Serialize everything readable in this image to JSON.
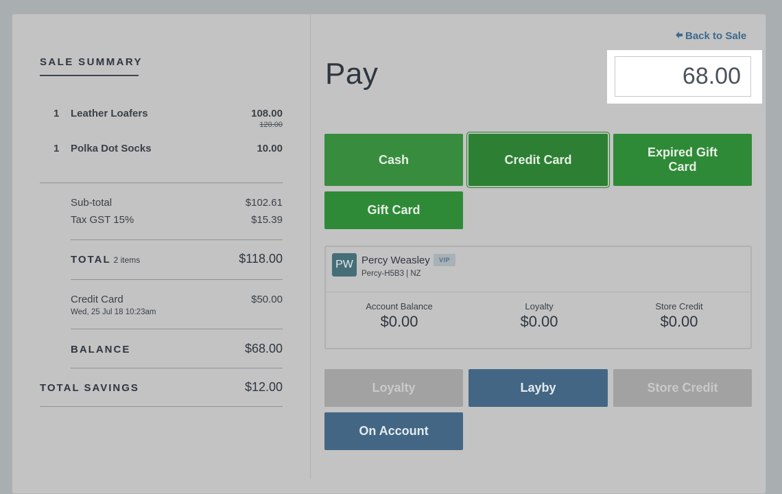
{
  "summary": {
    "title": "SALE SUMMARY",
    "items": [
      {
        "qty": "1",
        "name": "Leather Loafers",
        "price": "108.00",
        "original_price": "120.00"
      },
      {
        "qty": "1",
        "name": "Polka Dot Socks",
        "price": "10.00"
      }
    ],
    "subtotal_label": "Sub-total",
    "subtotal_value": "$102.61",
    "tax_label": "Tax GST 15%",
    "tax_value": "$15.39",
    "total_label": "TOTAL",
    "total_items": "2 items",
    "total_value": "$118.00",
    "payments": [
      {
        "method": "Credit Card",
        "date": "Wed, 25 Jul 18 10:23am",
        "amount": "$50.00"
      }
    ],
    "balance_label": "BALANCE",
    "balance_value": "$68.00",
    "savings_label": "TOTAL SAVINGS",
    "savings_value": "$12.00"
  },
  "pay": {
    "back_label": "Back to Sale",
    "title": "Pay",
    "amount": "68.00",
    "payment_methods": [
      "Cash",
      "Credit Card",
      "Expired Gift Card",
      "Gift Card"
    ],
    "selected_method": "Credit Card",
    "other_methods": [
      "Loyalty",
      "Layby",
      "Store Credit",
      "On Account"
    ]
  },
  "customer": {
    "initials": "PW",
    "name": "Percy Weasley",
    "badge": "VIP",
    "code": "Percy-H5B3 | NZ",
    "stats": [
      {
        "label": "Account Balance",
        "value": "$0.00"
      },
      {
        "label": "Loyalty",
        "value": "$0.00"
      },
      {
        "label": "Store Credit",
        "value": "$0.00"
      }
    ]
  },
  "colors": {
    "green": "#2f8a37",
    "blue": "#436684",
    "disabled": "#a2a2a2",
    "link": "#3d6a8c"
  }
}
